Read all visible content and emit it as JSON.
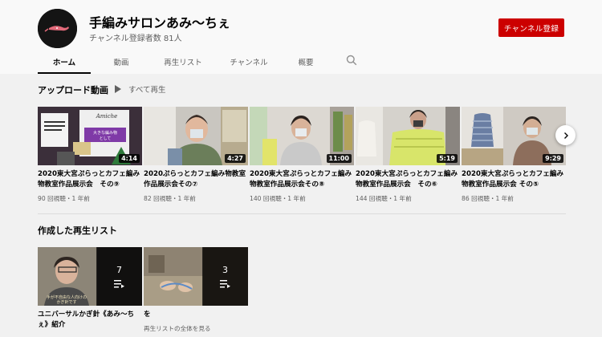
{
  "channel": {
    "name": "手編みサロンあみ〜ちぇ",
    "subscribers": "チャンネル登録者数 81人",
    "subscribe_label": "チャンネル登録"
  },
  "tabs": [
    {
      "label": "ホーム",
      "active": true
    },
    {
      "label": "動画",
      "active": false
    },
    {
      "label": "再生リスト",
      "active": false
    },
    {
      "label": "チャンネル",
      "active": false
    },
    {
      "label": "概要",
      "active": false
    }
  ],
  "uploads": {
    "title": "アップロード動画",
    "play_all": "すべて再生",
    "videos": [
      {
        "title": "2020東大宮ぷらっとカフェ編み物教室作品展示会　その⑨",
        "duration": "4:14",
        "meta": "90 回視聴・1 年前"
      },
      {
        "title": "2020ぷらっとカフェ編み物教室作品展示会その⑦",
        "duration": "4:27",
        "meta": "82 回視聴・1 年前"
      },
      {
        "title": "2020東大宮ぷらっとカフェ編み物教室作品展示会その⑧",
        "duration": "11:00",
        "meta": "140 回視聴・1 年前"
      },
      {
        "title": "2020東大宮ぷらっとカフェ編み物教室作品展示会　その⑥",
        "duration": "5:19",
        "meta": "144 回視聴・1 年前"
      },
      {
        "title": "2020東大宮ぷらっとカフェ編み物教室作品展示会 その⑤",
        "duration": "9:29",
        "meta": "86 回視聴・1 年前"
      }
    ]
  },
  "playlists": {
    "title": "作成した再生リスト",
    "items": [
      {
        "title": "ユニバーサルかぎ針《あみ〜ちぇ》紹介",
        "count": "7",
        "link": ""
      },
      {
        "title": "を",
        "count": "3",
        "link": "再生リストの全体を見る"
      }
    ]
  },
  "icons": {
    "search": "search-icon",
    "next": "chevron-right-icon",
    "play": "play-icon",
    "playlist": "playlist-icon"
  },
  "colors": {
    "subscribe": "#cc0000",
    "background": "#f1f1f1",
    "header": "#f9f9f9"
  }
}
